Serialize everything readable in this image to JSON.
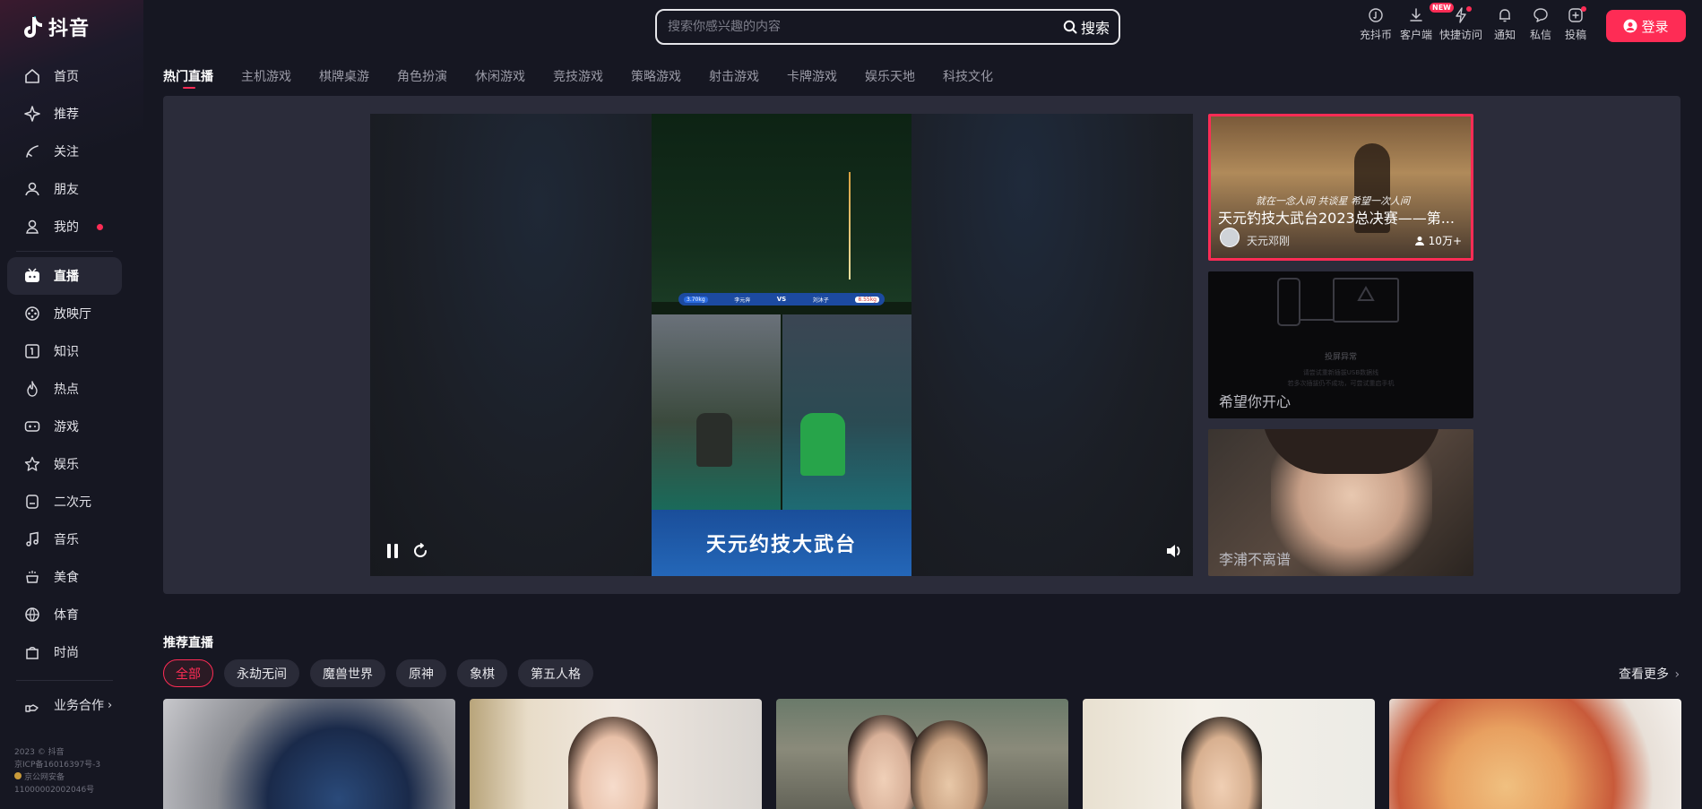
{
  "brand": {
    "logo_text": "抖音",
    "accent": "#fe2c55"
  },
  "sidebar": {
    "items": [
      {
        "label": "首页",
        "icon": "home-icon"
      },
      {
        "label": "推荐",
        "icon": "sparkle-icon"
      },
      {
        "label": "关注",
        "icon": "follow-icon"
      },
      {
        "label": "朋友",
        "icon": "friends-icon"
      },
      {
        "label": "我的",
        "icon": "user-icon"
      }
    ],
    "channels": [
      {
        "label": "直播",
        "icon": "live-tv-icon",
        "active": true
      },
      {
        "label": "放映厅",
        "icon": "cinema-icon"
      },
      {
        "label": "知识",
        "icon": "knowledge-icon"
      },
      {
        "label": "热点",
        "icon": "flame-icon"
      },
      {
        "label": "游戏",
        "icon": "gamepad-icon"
      },
      {
        "label": "娱乐",
        "icon": "star-icon"
      },
      {
        "label": "二次元",
        "icon": "anime-icon"
      },
      {
        "label": "音乐",
        "icon": "music-icon"
      },
      {
        "label": "美食",
        "icon": "food-icon"
      },
      {
        "label": "体育",
        "icon": "sports-icon"
      },
      {
        "label": "时尚",
        "icon": "fashion-icon"
      }
    ],
    "business": "业务合作",
    "footer": [
      "2023 © 抖音",
      "京ICP备16016397号-3",
      "京公网安备",
      "11000002002046号"
    ]
  },
  "header": {
    "search_placeholder": "搜索你感兴趣的内容",
    "search_button": "搜索",
    "actions": [
      {
        "label": "充抖币",
        "icon": "coin-icon"
      },
      {
        "label": "客户端",
        "icon": "download-icon",
        "badge": "NEW"
      },
      {
        "label": "快捷访问",
        "icon": "lightning-icon"
      },
      {
        "label": "通知",
        "icon": "bell-icon"
      },
      {
        "label": "私信",
        "icon": "message-icon"
      },
      {
        "label": "投稿",
        "icon": "upload-icon"
      }
    ],
    "login": "登录"
  },
  "categories": [
    "热门直播",
    "主机游戏",
    "棋牌桌游",
    "角色扮演",
    "休闲游戏",
    "竞技游戏",
    "策略游戏",
    "射击游戏",
    "卡牌游戏",
    "娱乐天地",
    "科技文化"
  ],
  "player": {
    "score_left": "3.70kg",
    "score_left_name": "李元奔",
    "vs": "VS",
    "score_right_name": "刘沐子",
    "score_right": "8.55kg",
    "banner": "天元约技大武台"
  },
  "rooms": [
    {
      "title": "天元钓技大武台2023总决赛——第...",
      "caption": "就在一念人间 共谈星 希望一次人间",
      "streamer": "天元邓刚",
      "viewers": "10万+"
    },
    {
      "title": "希望你开心",
      "error_title": "投屏异常",
      "error_line1": "请尝试重新插拔USB数据线",
      "error_line2": "若多次插拔仍不成功，可尝试重启手机"
    },
    {
      "title": "李浦不离谱"
    }
  ],
  "recommend": {
    "title": "推荐直播",
    "chips": [
      "全部",
      "永劫无间",
      "魔兽世界",
      "原神",
      "象棋",
      "第五人格"
    ],
    "see_more": "查看更多"
  }
}
